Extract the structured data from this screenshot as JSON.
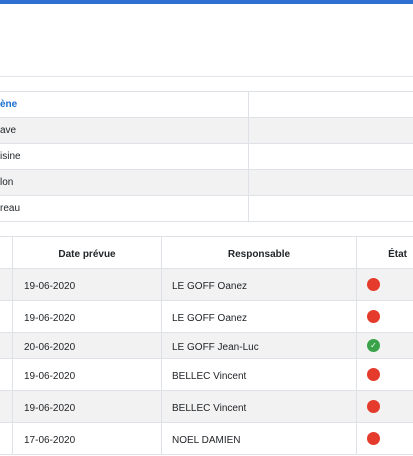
{
  "colors": {
    "accent": "#2f6fd1",
    "status_red": "#e53b2c",
    "status_green": "#3aa34a",
    "zebra": "#f2f2f2"
  },
  "area_table": {
    "header": "ène",
    "rows": [
      "ave",
      "isine",
      "lon",
      "reau"
    ]
  },
  "task_table": {
    "columns": [
      "Date prévue",
      "Responsable",
      "État"
    ],
    "rows": [
      {
        "date": "19-06-2020",
        "responsable": "LE GOFF Oanez",
        "etat": "red"
      },
      {
        "date": "19-06-2020",
        "responsable": "LE GOFF Oanez",
        "etat": "red"
      },
      {
        "date": "20-06-2020",
        "responsable": "LE GOFF Jean-Luc",
        "etat": "green",
        "etat_glyph": "✓"
      },
      {
        "date": "19-06-2020",
        "responsable": "BELLEC Vincent",
        "etat": "red"
      },
      {
        "date": "19-06-2020",
        "responsable": "BELLEC Vincent",
        "etat": "red"
      },
      {
        "date": "17-06-2020",
        "responsable": "NOEL DAMIEN",
        "etat": "red"
      }
    ]
  }
}
